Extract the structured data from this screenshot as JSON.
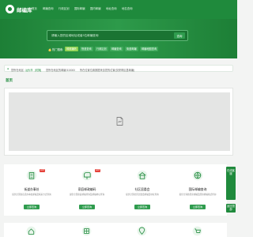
{
  "brand": {
    "name": "邮编库"
  },
  "nav": {
    "items": [
      "首页",
      "邮编查询",
      "行政区划",
      "国际邮编",
      "国内邮编",
      "地址查询",
      "地名查询"
    ]
  },
  "search": {
    "placeholder": "请输入您的区域地址或者3位邮编查询",
    "button_label": "查询"
  },
  "hot": {
    "label": "热门搜索:",
    "tags": [
      "邮政编码",
      "快递查询",
      "行政区划",
      "邮编查询",
      "街道邮编",
      "邮编地图查询"
    ],
    "active_index": 0
  },
  "location": {
    "prefix": "您所在地区:",
    "city": "汕头市",
    "change": "[切换]",
    "ip_text": "您所在地区的邮编 515000",
    "tail": "所在位置位置数据来自您的位置(仅获得区县邮编)"
  },
  "section": {
    "title": "首页"
  },
  "cards": [
    {
      "title": "街道办事处",
      "desc": "提供全国各街道办事处邮编及联系方式查询",
      "button": "立即查询",
      "badge": "HOT",
      "icon": "building-icon"
    },
    {
      "title": "家庭邮政编码",
      "desc": "提供全国家庭邮编查询及邮编地址查询",
      "button": "立即查询",
      "badge": "HOT",
      "icon": "mailbox-icon"
    },
    {
      "title": "社区居委会",
      "desc": "提供全国社区居委会邮编及地址查询",
      "button": "立即查询",
      "badge": "",
      "icon": "community-icon"
    },
    {
      "title": "国际邮编查询",
      "desc": "提供全球各国家邮编及国际邮编格式查询",
      "button": "立即查询",
      "badge": "",
      "icon": "globe-icon"
    }
  ],
  "float": {
    "service": "在线客服",
    "top": "返回顶部"
  },
  "colors": {
    "primary": "#1f8a3c",
    "accent": "#8fd24f",
    "badge": "#e5423a"
  }
}
